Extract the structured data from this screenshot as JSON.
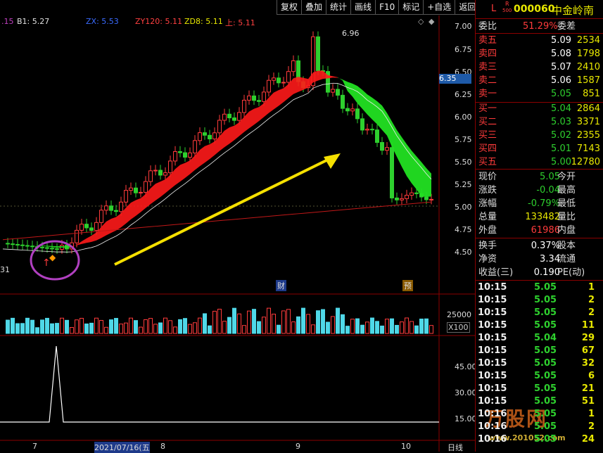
{
  "toolbar": [
    "复权",
    "叠加",
    "统计",
    "画线",
    "F10",
    "标记",
    "+自选",
    "返回"
  ],
  "indicators": {
    "a": ".15",
    "b1": "B1: 5.27",
    "zx": "ZX: 5.53",
    "zy120": "ZY120: 5.11",
    "zd8": "ZD8: 5.11",
    "shang": "上: 5.11"
  },
  "price_axis": [
    "7.00",
    "6.75",
    "6.50",
    "6.25",
    "6.00",
    "5.75",
    "5.50",
    "5.25",
    "5.00",
    "4.75",
    "4.50"
  ],
  "current_price_tag": "6.35",
  "high_marker": "6.96",
  "left_label": "31",
  "event_badges": [
    "财",
    "预"
  ],
  "volume_axis": "25000",
  "volume_unit": "X100",
  "indicator_axis": [
    "45.00",
    "30.00",
    "15.00"
  ],
  "date_axis": [
    "7",
    "2021/07/16(五",
    "8",
    "9",
    "10"
  ],
  "date_axis_right": "日线",
  "stock": {
    "prefix": "L",
    "r_badge": "R",
    "r_sub": "500",
    "code": "000060",
    "name": "中金岭南"
  },
  "wb": {
    "label1": "委比",
    "value": "51.29%",
    "label2": "委差"
  },
  "asks": [
    {
      "label": "卖五",
      "price": "5.09",
      "vol": "2534"
    },
    {
      "label": "卖四",
      "price": "5.08",
      "vol": "1798"
    },
    {
      "label": "卖三",
      "price": "5.07",
      "vol": "2410"
    },
    {
      "label": "卖二",
      "price": "5.06",
      "vol": "1587"
    },
    {
      "label": "卖一",
      "price": "5.05",
      "vol": "851"
    }
  ],
  "bids": [
    {
      "label": "买一",
      "price": "5.04",
      "vol": "2864"
    },
    {
      "label": "买二",
      "price": "5.03",
      "vol": "3371"
    },
    {
      "label": "买三",
      "price": "5.02",
      "vol": "2355"
    },
    {
      "label": "买四",
      "price": "5.01",
      "vol": "7143"
    },
    {
      "label": "买五",
      "price": "5.00",
      "vol": "12780"
    }
  ],
  "quote": [
    {
      "l1": "现价",
      "v1": "5.05",
      "l2": "今开",
      "c": "green"
    },
    {
      "l1": "涨跌",
      "v1": "-0.04",
      "l2": "最高",
      "c": "green"
    },
    {
      "l1": "涨幅",
      "v1": "-0.79%",
      "l2": "最低",
      "c": "green"
    },
    {
      "l1": "总量",
      "v1": "133482",
      "l2": "量比",
      "c": "yellow"
    },
    {
      "l1": "外盘",
      "v1": "61986",
      "l2": "内盘",
      "c": "red"
    }
  ],
  "stats": [
    {
      "l1": "换手",
      "v1": "0.37%",
      "l2": "股本"
    },
    {
      "l1": "净资",
      "v1": "3.34",
      "l2": "流通"
    },
    {
      "l1": "收益(三)",
      "v1": "0.190",
      "l2": "PE(动)"
    }
  ],
  "ticks": [
    {
      "time": "10:15",
      "price": "5.05",
      "vol": "1"
    },
    {
      "time": "10:15",
      "price": "5.05",
      "vol": "2"
    },
    {
      "time": "10:15",
      "price": "5.05",
      "vol": "2"
    },
    {
      "time": "10:15",
      "price": "5.05",
      "vol": "11"
    },
    {
      "time": "10:15",
      "price": "5.04",
      "vol": "29"
    },
    {
      "time": "10:15",
      "price": "5.05",
      "vol": "67"
    },
    {
      "time": "10:15",
      "price": "5.05",
      "vol": "32"
    },
    {
      "time": "10:15",
      "price": "5.05",
      "vol": "6"
    },
    {
      "time": "10:15",
      "price": "5.05",
      "vol": "21"
    },
    {
      "time": "10:15",
      "price": "5.05",
      "vol": "51"
    },
    {
      "time": "10:16",
      "price": "5.05",
      "vol": "1"
    },
    {
      "time": "10:16",
      "price": "5.05",
      "vol": "2"
    },
    {
      "time": "10:16",
      "price": "5.05",
      "vol": "24"
    }
  ],
  "watermark": {
    "text": "万股网",
    "url": "www.201052.com"
  }
}
